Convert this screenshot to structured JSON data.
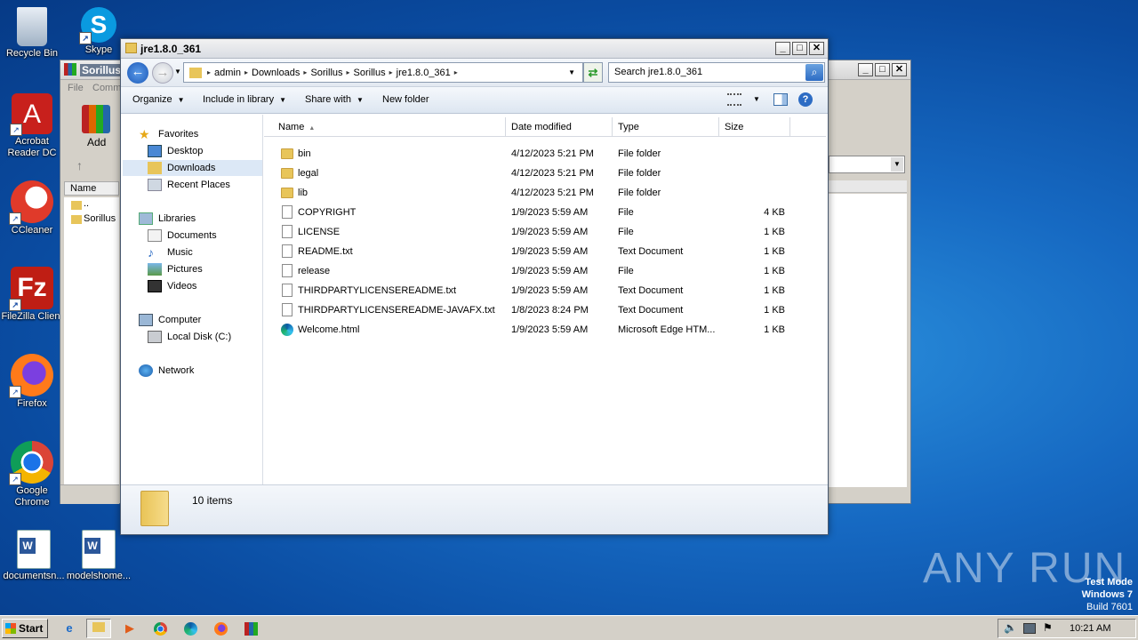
{
  "desktop": {
    "icons": [
      {
        "label": "Recycle Bin",
        "icon": "recycle-bin-icon"
      },
      {
        "label": "Skype",
        "icon": "skype-icon"
      },
      {
        "label": "Acrobat Reader DC",
        "line1": "Acrobat",
        "line2": "Reader DC",
        "icon": "acrobat-icon"
      },
      {
        "label": "CCleaner",
        "icon": "ccleaner-icon"
      },
      {
        "label": "FileZilla Client",
        "icon": "filezilla-icon"
      },
      {
        "label": "Firefox",
        "icon": "firefox-icon"
      },
      {
        "label": "Google Chrome",
        "line1": "Google",
        "line2": "Chrome",
        "icon": "chrome-icon"
      },
      {
        "label": "documentsn...",
        "icon": "word-doc-icon"
      },
      {
        "label": "modelshome...",
        "icon": "word-doc-icon"
      }
    ],
    "watermark": "ANY RUN",
    "os_line1": "Test Mode",
    "os_line2": "Windows 7",
    "os_line3": "Build 7601"
  },
  "back_window": {
    "title": "Sorillus.",
    "menu_file": "File",
    "menu_comm": "Comm",
    "add_label": "Add",
    "col_name": "Name",
    "items": [
      "..",
      "Sorillus"
    ]
  },
  "window": {
    "title": "jre1.8.0_361",
    "breadcrumbs": [
      "admin",
      "Downloads",
      "Sorillus",
      "Sorillus",
      "jre1.8.0_361"
    ],
    "search_placeholder": "Search jre1.8.0_361",
    "toolbar": {
      "organize": "Organize",
      "include": "Include in library",
      "share": "Share with",
      "new_folder": "New folder"
    },
    "nav": {
      "favorites": "Favorites",
      "desktop": "Desktop",
      "downloads": "Downloads",
      "recent": "Recent Places",
      "libraries": "Libraries",
      "documents": "Documents",
      "music": "Music",
      "pictures": "Pictures",
      "videos": "Videos",
      "computer": "Computer",
      "local_disk": "Local Disk (C:)",
      "network": "Network"
    },
    "columns": {
      "name": "Name",
      "date": "Date modified",
      "type": "Type",
      "size": "Size"
    },
    "files": [
      {
        "name": "bin",
        "date": "4/12/2023 5:21 PM",
        "type": "File folder",
        "size": "",
        "kind": "folder"
      },
      {
        "name": "legal",
        "date": "4/12/2023 5:21 PM",
        "type": "File folder",
        "size": "",
        "kind": "folder"
      },
      {
        "name": "lib",
        "date": "4/12/2023 5:21 PM",
        "type": "File folder",
        "size": "",
        "kind": "folder"
      },
      {
        "name": "COPYRIGHT",
        "date": "1/9/2023 5:59 AM",
        "type": "File",
        "size": "4 KB",
        "kind": "file"
      },
      {
        "name": "LICENSE",
        "date": "1/9/2023 5:59 AM",
        "type": "File",
        "size": "1 KB",
        "kind": "file"
      },
      {
        "name": "README.txt",
        "date": "1/9/2023 5:59 AM",
        "type": "Text Document",
        "size": "1 KB",
        "kind": "file"
      },
      {
        "name": "release",
        "date": "1/9/2023 5:59 AM",
        "type": "File",
        "size": "1 KB",
        "kind": "file"
      },
      {
        "name": "THIRDPARTYLICENSEREADME.txt",
        "date": "1/9/2023 5:59 AM",
        "type": "Text Document",
        "size": "1 KB",
        "kind": "file"
      },
      {
        "name": "THIRDPARTYLICENSEREADME-JAVAFX.txt",
        "date": "1/8/2023 8:24 PM",
        "type": "Text Document",
        "size": "1 KB",
        "kind": "file"
      },
      {
        "name": "Welcome.html",
        "date": "1/9/2023 5:59 AM",
        "type": "Microsoft Edge HTM...",
        "size": "1 KB",
        "kind": "edge"
      }
    ],
    "status": "10 items"
  },
  "taskbar": {
    "start": "Start",
    "clock": "10:21 AM"
  }
}
